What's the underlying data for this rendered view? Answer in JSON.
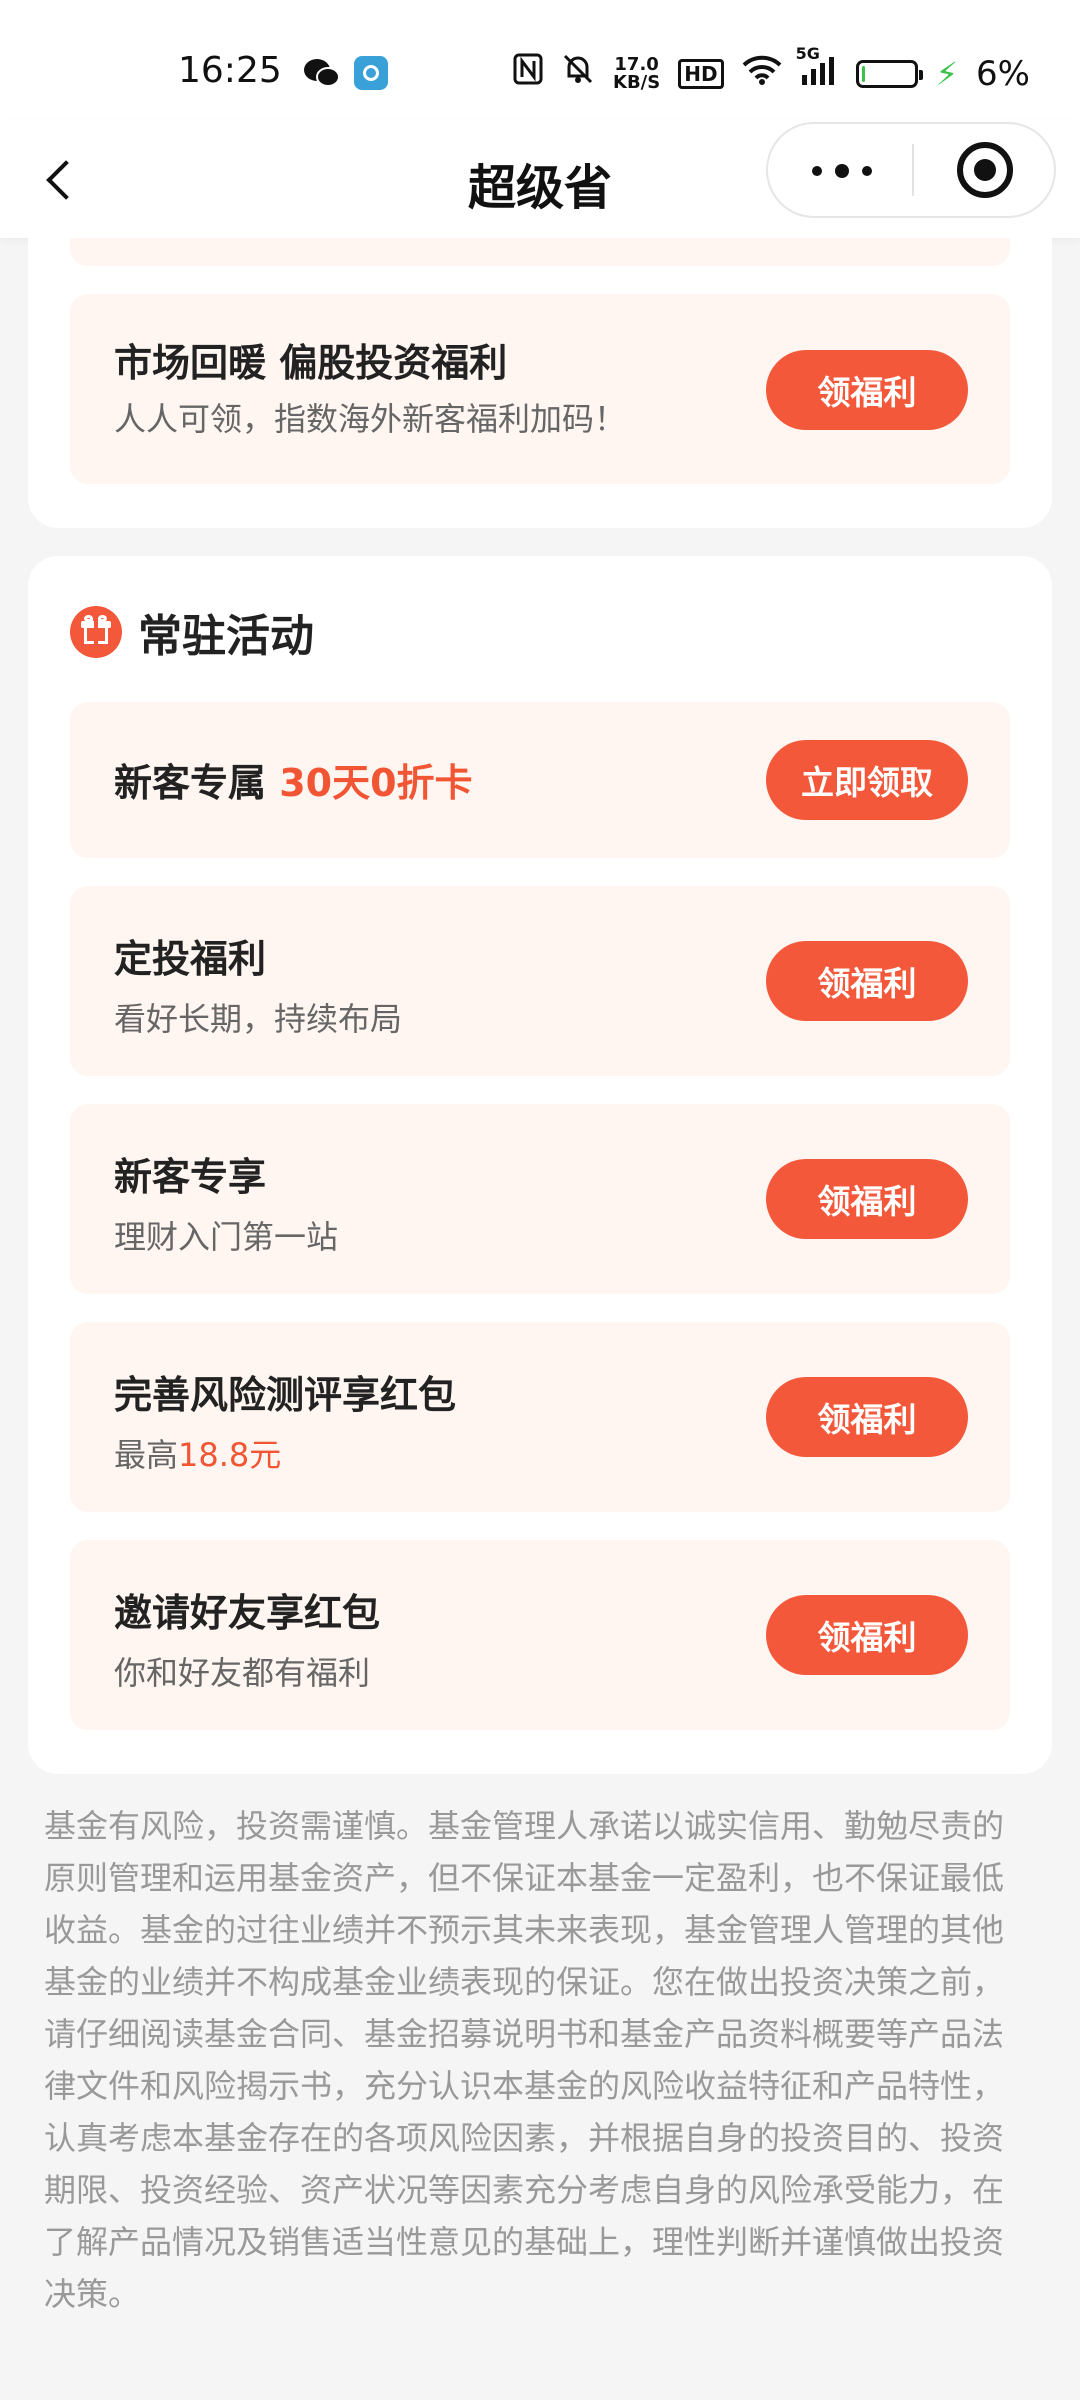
{
  "status_bar": {
    "time": "16:25",
    "network_speed_value": "17.0",
    "network_speed_unit": "KB/S",
    "hd_label": "HD",
    "signal_label": "5G",
    "battery_percent": 6,
    "battery_text": "6%",
    "icons": [
      "wechat-icon",
      "gallery-icon",
      "nfc-icon",
      "mute-icon",
      "wifi-icon",
      "signal-icon",
      "battery-icon",
      "charging-icon"
    ]
  },
  "nav": {
    "title": "超级省",
    "back_icon": "chevron-left-icon",
    "more_icon": "more-dots-icon",
    "close_icon": "target-icon"
  },
  "top_card": {
    "row": {
      "title": "市场回暖 偏股投资福利",
      "subtitle": "人人可领，指数海外新客福利加码！",
      "button": "领福利"
    }
  },
  "regular": {
    "title": "常驻活动",
    "icon": "gift-icon",
    "new_customer": {
      "title_prefix": "新客专属 ",
      "title_highlight": "30天0折卡",
      "button": "立即领取"
    },
    "items": [
      {
        "title": "定投福利",
        "subtitle": "看好长期，持续布局",
        "button": "领福利"
      },
      {
        "title": "新客专享",
        "subtitle": "理财入门第一站",
        "button": "领福利"
      },
      {
        "title": "完善风险测评享红包",
        "subtitle_prefix": "最高",
        "subtitle_highlight": "18.8元",
        "button": "领福利"
      },
      {
        "title": "邀请好友享红包",
        "subtitle": "你和好友都有福利",
        "button": "领福利"
      }
    ]
  },
  "disclaimer": "基金有风险，投资需谨慎。基金管理人承诺以诚实信用、勤勉尽责的原则管理和运用基金资产，但不保证本基金一定盈利，也不保证最低收益。基金的过往业绩并不预示其未来表现，基金管理人管理的其他基金的业绩并不构成基金业绩表现的保证。您在做出投资决策之前，请仔细阅读基金合同、基金招募说明书和基金产品资料概要等产品法律文件和风险揭示书，充分认识本基金的风险收益特征和产品特性，认真考虑本基金存在的各项风险因素，并根据自身的投资目的、投资期限、投资经验、资产状况等因素充分考虑自身的风险承受能力，在了解产品情况及销售适当性意见的基础上，理性判断并谨慎做出投资决策。",
  "colors": {
    "accent": "#f4583b",
    "highlight_text": "#f25533",
    "row_background": "#fff5f1",
    "page_background": "#f5f5f5"
  }
}
